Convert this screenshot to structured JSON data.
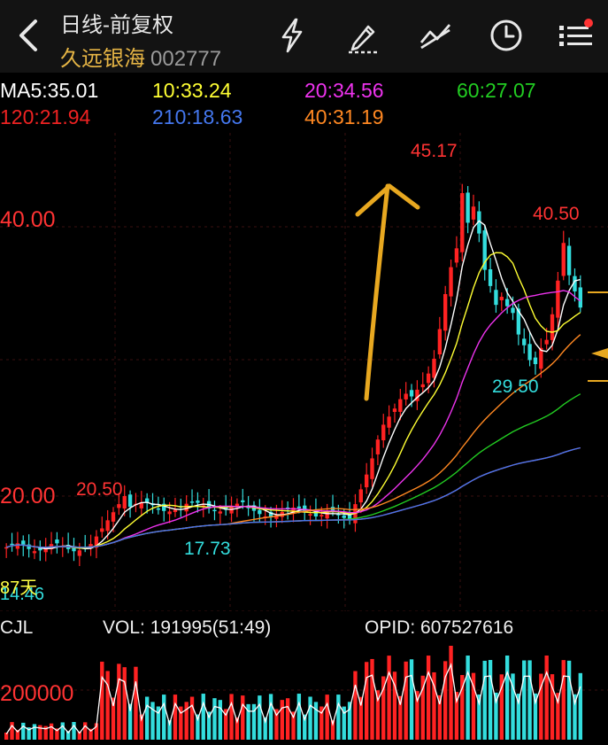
{
  "header": {
    "title": "日线-前复权",
    "stock_name": "久远银海",
    "stock_code": "002777",
    "tools": [
      "lightning-icon",
      "draw-pen-icon",
      "trendline-icon",
      "clock-icon",
      "menu-icon"
    ]
  },
  "ma": {
    "ma5": {
      "label": "MA5:35.01",
      "color": "#ffffff"
    },
    "ma10": {
      "label": "10:33.24",
      "color": "#ffff33"
    },
    "ma20": {
      "label": "20:34.56",
      "color": "#ee33ee"
    },
    "ma60": {
      "label": "60:27.07",
      "color": "#22cc22"
    },
    "ma120": {
      "label": "120:21.94",
      "color": "#ee2222"
    },
    "ma210": {
      "label": "210:18.63",
      "color": "#4477ee"
    },
    "ma40": {
      "label": "40:31.19",
      "color": "#ff8822"
    }
  },
  "chart": {
    "y_labels": [
      "40.00",
      "20.00"
    ],
    "high_label": "45.17",
    "second_high_label": "40.50",
    "left_high_label": "20.50",
    "low_label_1": "17.73",
    "low_label_2": "29.50",
    "bottom_low_label": "14.46",
    "days_label": "87天"
  },
  "volume": {
    "cjl": "CJL",
    "vol": "VOL: 191995(51:49)",
    "opid": "OPID: 607527616",
    "y_label": "200000"
  },
  "colors": {
    "up": "#ff2222",
    "down": "#33dddd",
    "bg": "#000000",
    "accent": "#e6b545"
  }
}
